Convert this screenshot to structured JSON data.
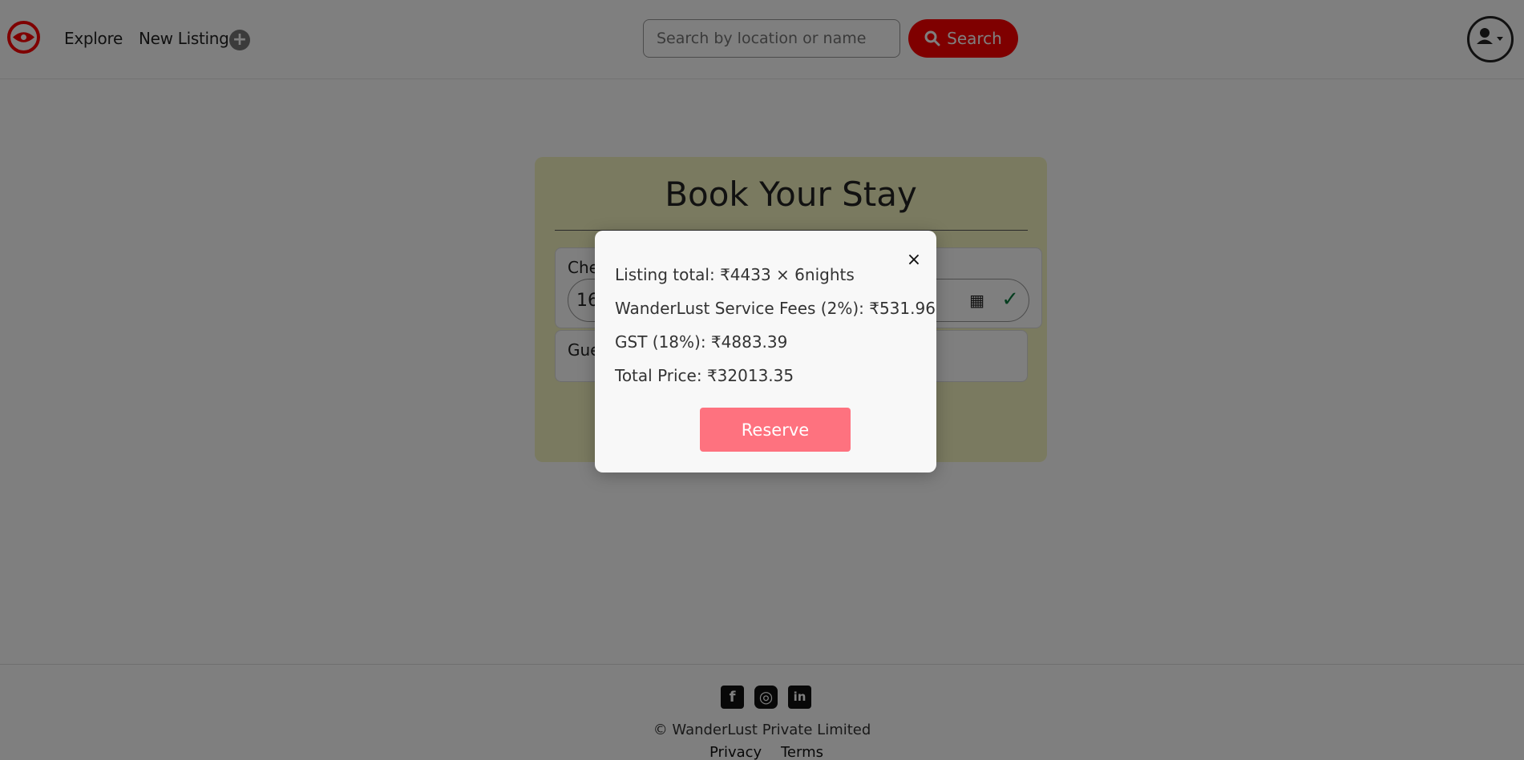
{
  "navbar": {
    "explore_label": "Explore",
    "new_listing_label": "New Listing",
    "search_placeholder": "Search by location or name",
    "search_button_label": "Search",
    "brand_color": "#fe0000"
  },
  "booking_card": {
    "title": "Book Your Stay",
    "checkin_label": "Che",
    "checkin_value": "16",
    "guests_label": "Gue"
  },
  "modal": {
    "listing_total": "Listing total: ₹4433 × 6nights",
    "service_fees": "WanderLust Service Fees (2%): ₹531.96",
    "gst": "GST (18%): ₹4883.39",
    "total_price": "Total Price: ₹32013.35",
    "reserve_label": "Reserve",
    "close_symbol": "×"
  },
  "footer": {
    "copyright": "© WanderLust Private Limited",
    "privacy_label": "Privacy",
    "terms_label": "Terms",
    "social_icons": [
      "facebook-icon",
      "instagram-icon",
      "linkedin-icon"
    ]
  }
}
